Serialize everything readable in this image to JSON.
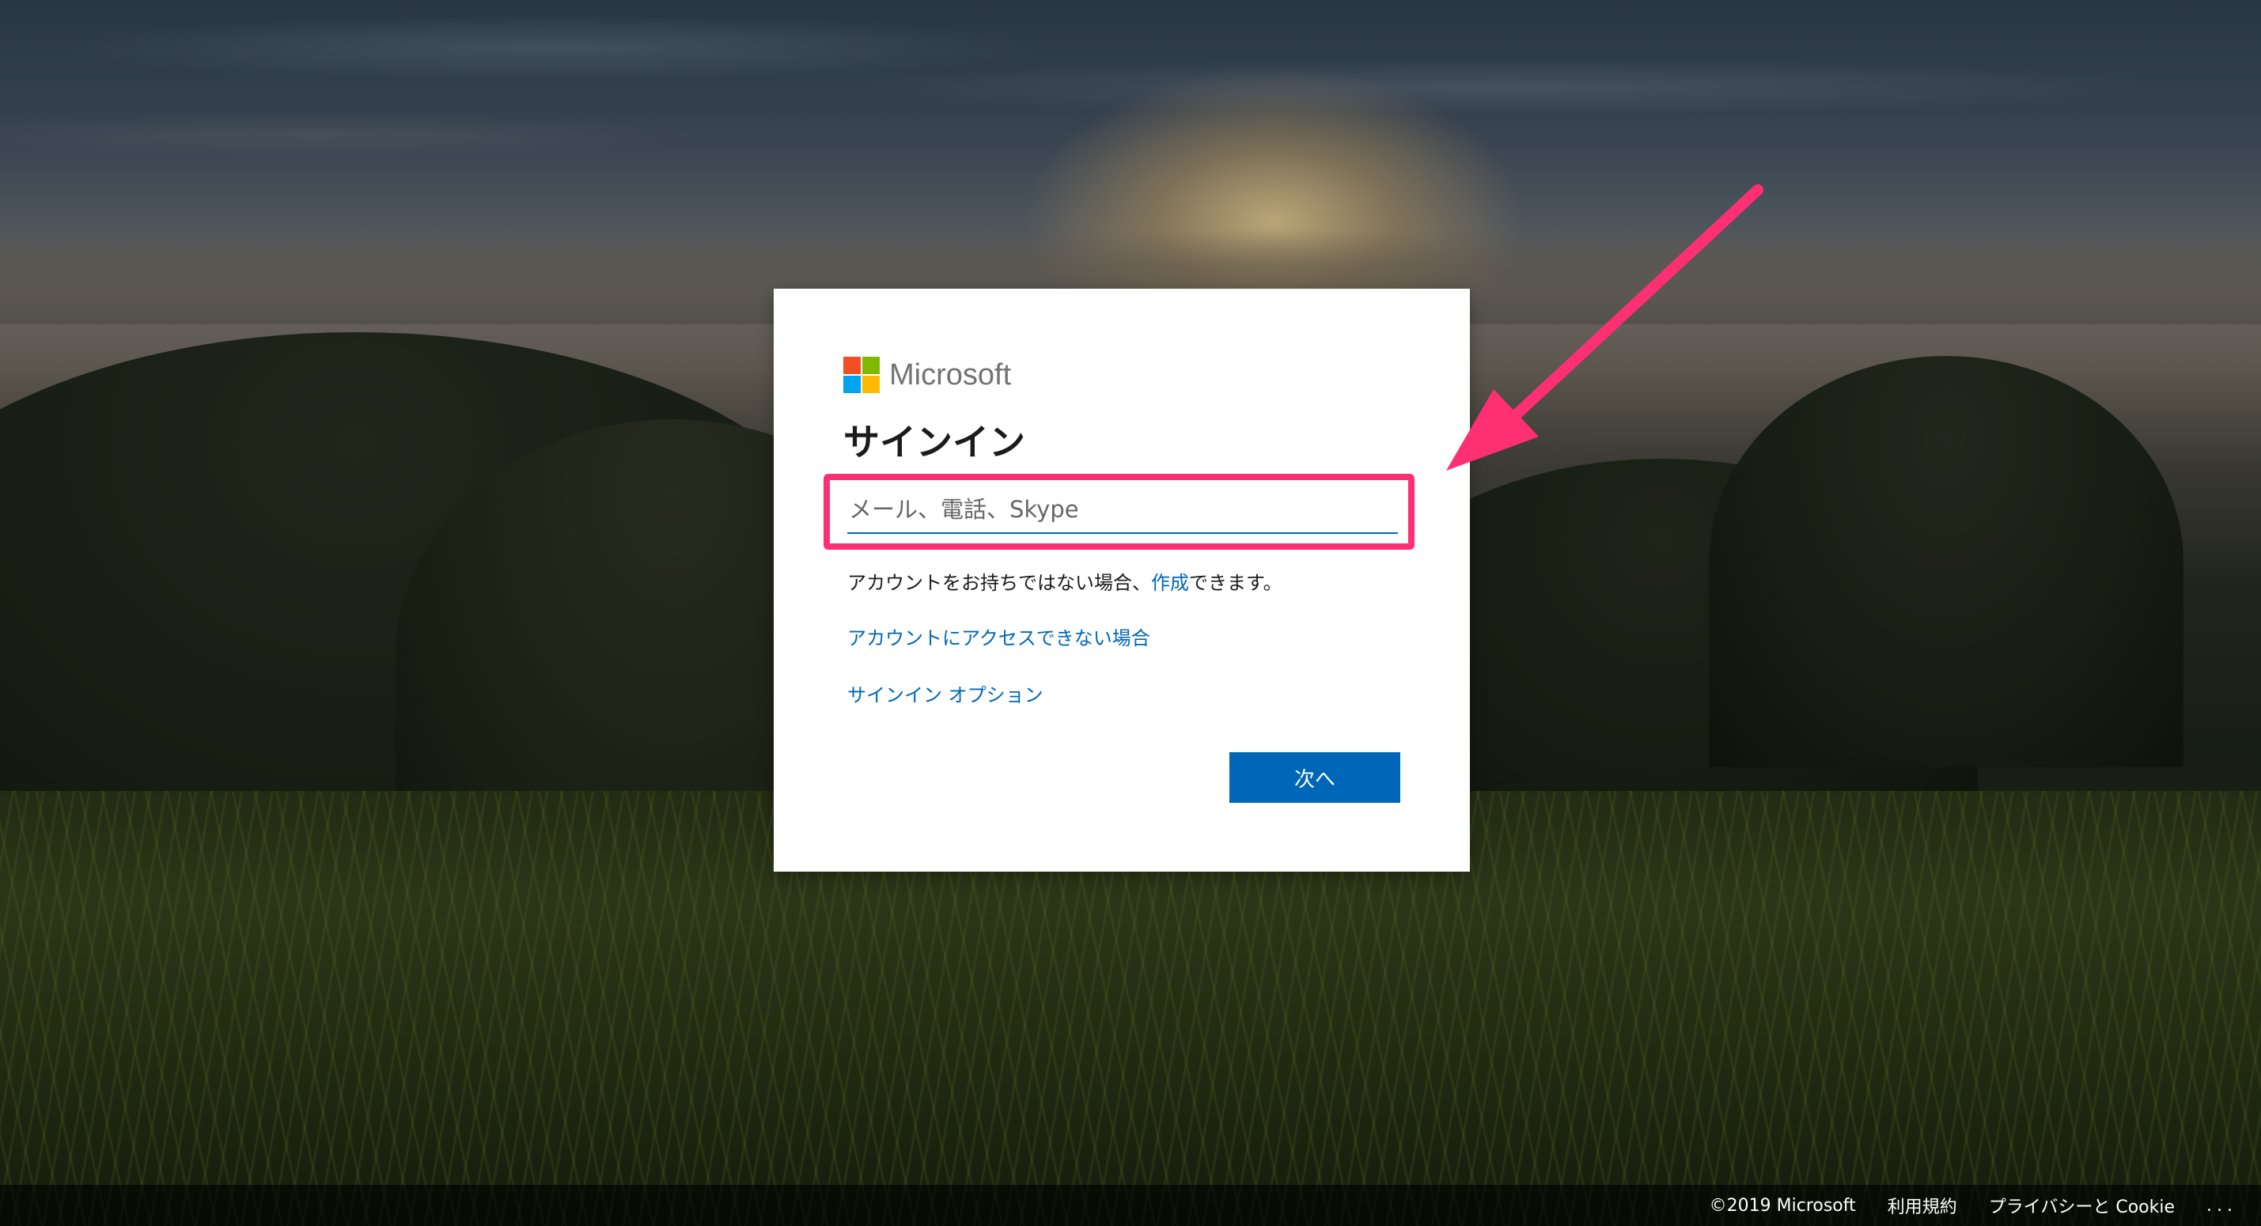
{
  "brand": {
    "name": "Microsoft",
    "logo_colors": [
      "#f25022",
      "#7fba00",
      "#00a4ef",
      "#ffb900"
    ]
  },
  "signin": {
    "title": "サインイン",
    "email_placeholder": "メール、電話、Skype",
    "no_account_prefix": "アカウントをお持ちではない場合、",
    "create_link": "作成",
    "no_account_suffix": "できます。",
    "cant_access_link": "アカウントにアクセスできない場合",
    "options_link": "サインイン オプション",
    "next_button": "次へ"
  },
  "annotation": {
    "highlight_color": "#ff2f74"
  },
  "footer": {
    "copyright": "©2019 Microsoft",
    "terms": "利用規約",
    "privacy": "プライバシーと Cookie",
    "more": "..."
  },
  "colors": {
    "accent": "#0067b8"
  }
}
